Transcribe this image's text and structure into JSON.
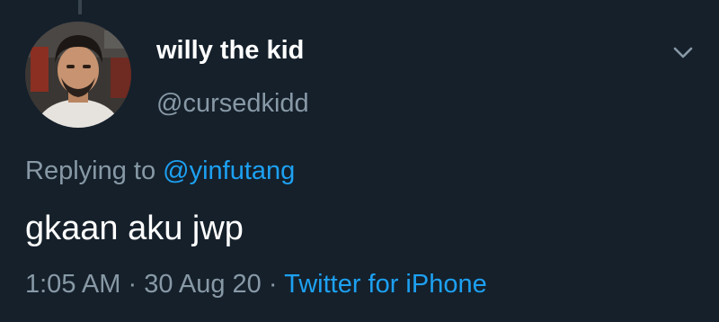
{
  "tweet": {
    "display_name": "willy the kid",
    "handle": "@cursedkidd",
    "replying_prefix": "Replying to ",
    "replying_to": "@yinfutang",
    "text": "gkaan aku jwp",
    "time": "1:05 AM",
    "separator": " · ",
    "date": "30 Aug 20",
    "source": "Twitter for iPhone"
  },
  "icons": {
    "more": "chevron-down-icon",
    "avatar": "profile-photo"
  },
  "colors": {
    "background": "#15202b",
    "primary_text": "#ffffff",
    "secondary_text": "#8899a6",
    "link": "#1da1f2"
  }
}
